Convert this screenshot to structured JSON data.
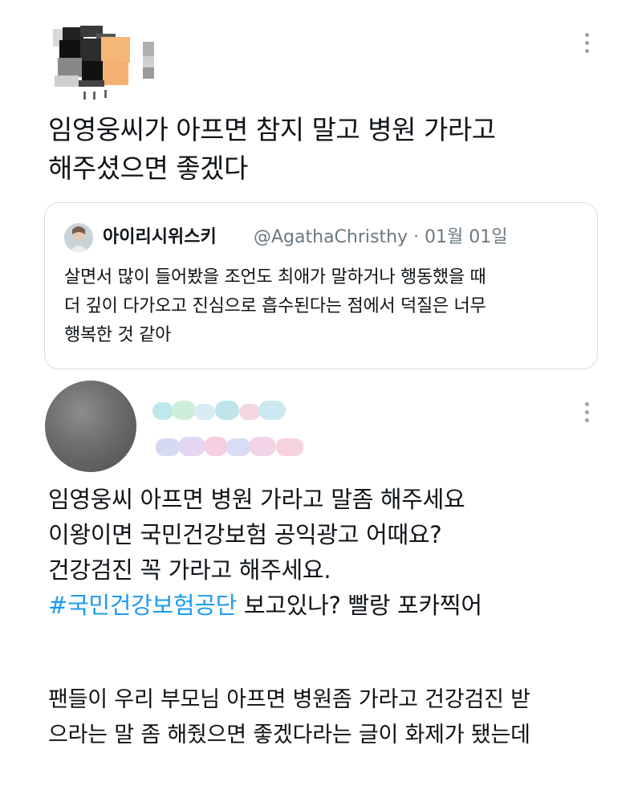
{
  "tweet1": {
    "text_line1": "임영웅씨가 아프면 참지 말고 병원 가라고",
    "text_line2": "해주셨으면 좋겠다"
  },
  "quote": {
    "display_name": "아이리시위스키",
    "handle_date": "@AgathaChristhy · 01월 01일",
    "text_line1": "살면서 많이 들어봤을 조언도 최애가 말하거나 행동했을 때",
    "text_line2": "더 깊이 다가오고 진심으로 흡수된다는 점에서 덕질은 너무",
    "text_line3": "행복한 것 같아"
  },
  "tweet2": {
    "line1": "임영웅씨 아프면 병원 가라고 말좀 해주세요",
    "line2": "이왕이면 국민건강보험 공익광고 어때요?",
    "line3": "건강검진 꼭 가라고 해주세요.",
    "hashtag": "#국민건강보험공단",
    "line4_rest": " 보고있나? 빨랑 포카찍어"
  },
  "caption": {
    "line1": "팬들이 우리 부모님 아프면 병원좀 가라고 건강검진 받",
    "line2": "으라는 말 좀 해줬으면 좋겠다라는 글이 화제가 됐는데"
  },
  "icons": {
    "tweet_menu": "more-vertical-icon",
    "hashtag_color": "#1d9bf0"
  }
}
